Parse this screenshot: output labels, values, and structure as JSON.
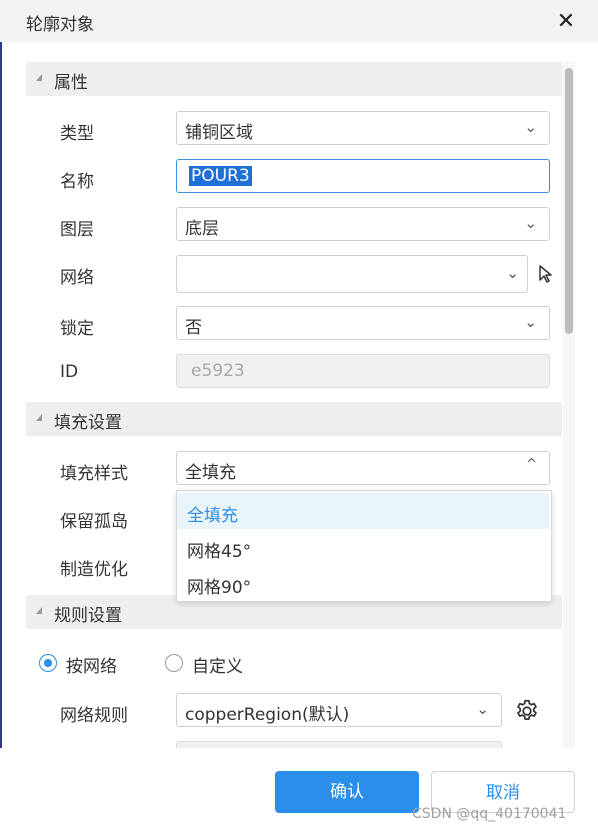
{
  "dialog": {
    "title": "轮廓对象"
  },
  "sections": {
    "properties": "属性",
    "fill": "填充设置",
    "rules": "规则设置"
  },
  "properties": {
    "type_label": "类型",
    "type_value": "铺铜区域",
    "name_label": "名称",
    "name_value": "POUR3",
    "layer_label": "图层",
    "layer_value": "底层",
    "net_label": "网络",
    "net_value": "",
    "lock_label": "锁定",
    "lock_value": "否",
    "id_label": "ID",
    "id_value": "e5923"
  },
  "fill": {
    "style_label": "填充样式",
    "style_value": "全填充",
    "keep_islands_label": "保留孤岛",
    "optimize_label": "制造优化",
    "options": [
      "全填充",
      "网格45°",
      "网格90°"
    ]
  },
  "rules": {
    "by_net_label": "按网络",
    "custom_label": "自定义",
    "net_rule_label": "网络规则",
    "net_rule_value": "copperRegion(默认)"
  },
  "footer": {
    "confirm": "确认",
    "cancel": "取消"
  },
  "watermark": "CSDN @qq_40170041",
  "colors": {
    "accent": "#2b8ee8",
    "section_bg": "#eeeeee",
    "title_bg": "#f2f2f2"
  }
}
